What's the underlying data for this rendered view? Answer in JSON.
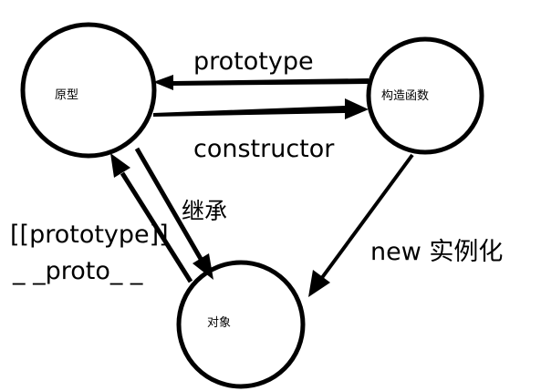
{
  "nodes": {
    "prototype": {
      "label": "原型"
    },
    "constructor_fn": {
      "label": "构造函数"
    },
    "object": {
      "label": "对象"
    }
  },
  "edges": {
    "prototype_label": "prototype",
    "constructor_label": "constructor",
    "inherit_label": "继承",
    "instantiate_label": "new 实例化",
    "proto_label_line1": "[[prototype]]",
    "proto_label_line2": "_ _proto_ _"
  },
  "colors": {
    "stroke": "#000000",
    "background": "#ffffff"
  }
}
